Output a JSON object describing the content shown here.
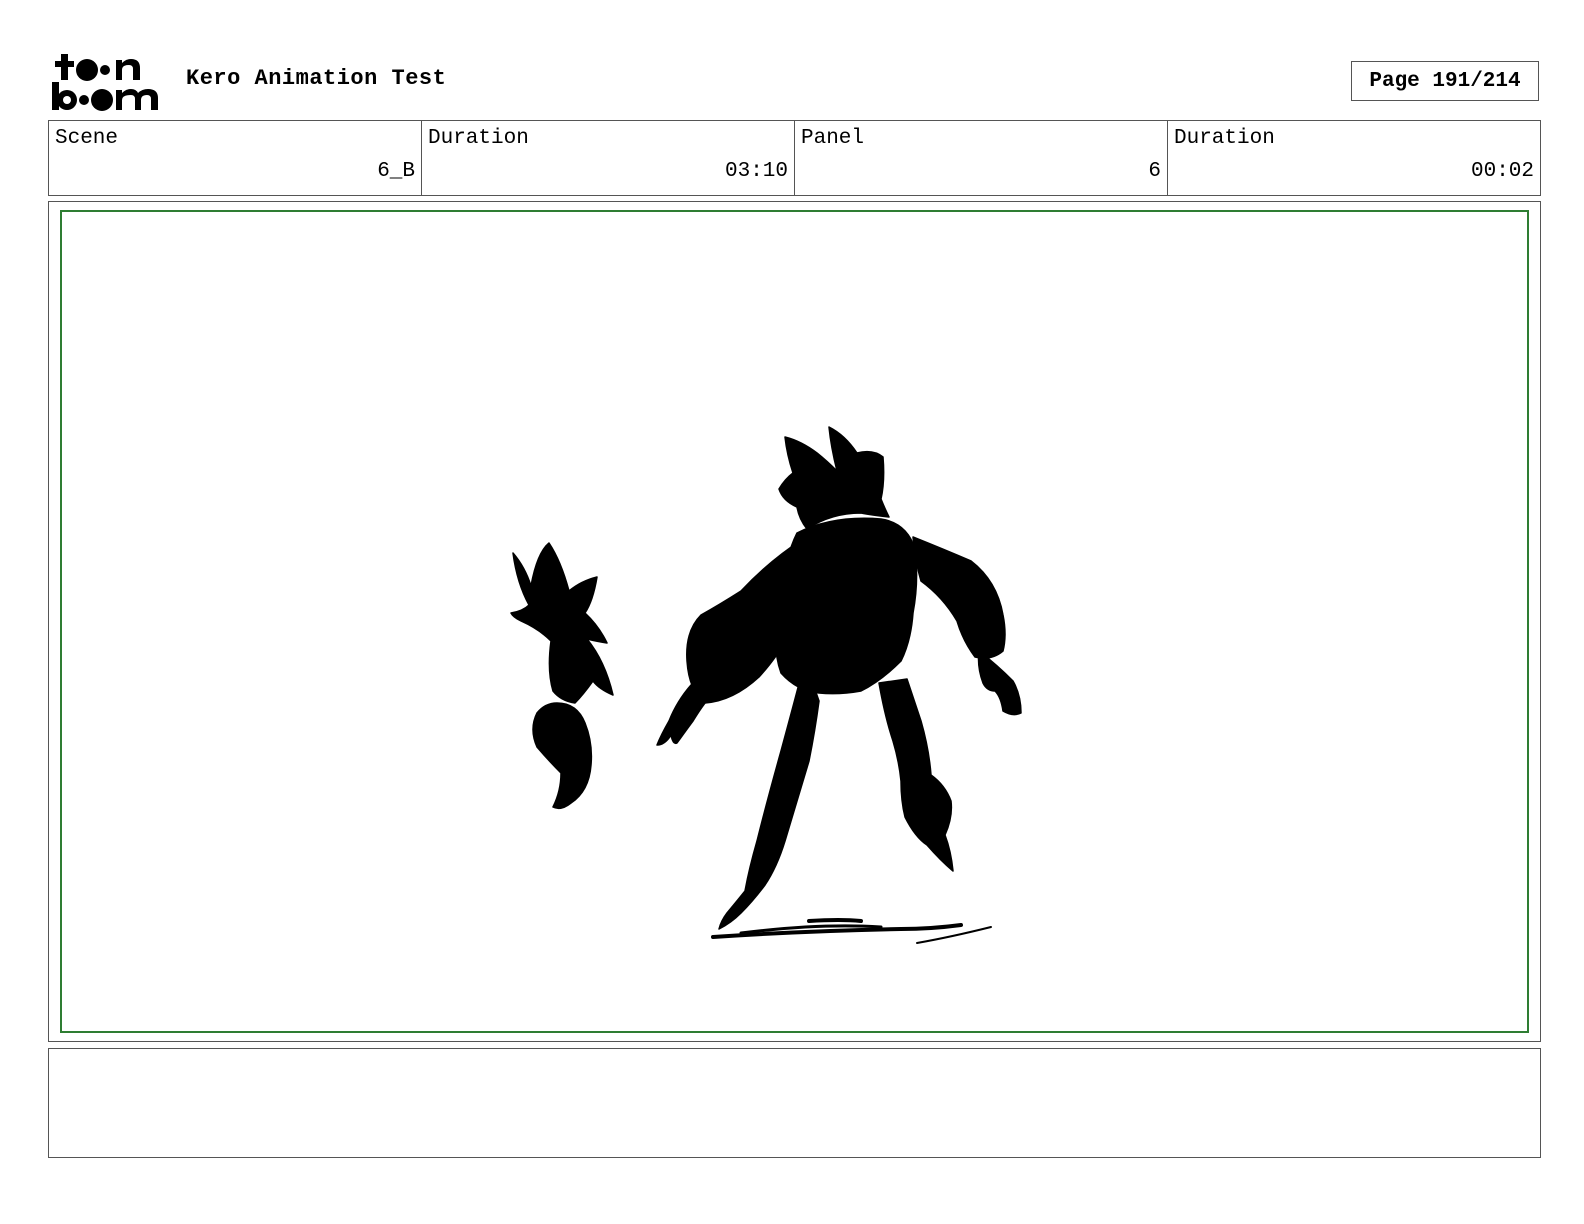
{
  "header": {
    "logo_text": "toon boom",
    "title": "Kero Animation Test",
    "page_indicator": "Page 191/214"
  },
  "info": [
    {
      "label": "Scene",
      "value": "6_B"
    },
    {
      "label": "Duration",
      "value": "03:10"
    },
    {
      "label": "Panel",
      "value": "6"
    },
    {
      "label": "Duration",
      "value": "00:02"
    }
  ],
  "panel": {
    "drawing": "black-silhouette-sketch",
    "safe_area_color": "#2e7d32"
  },
  "notes": {
    "text": ""
  }
}
